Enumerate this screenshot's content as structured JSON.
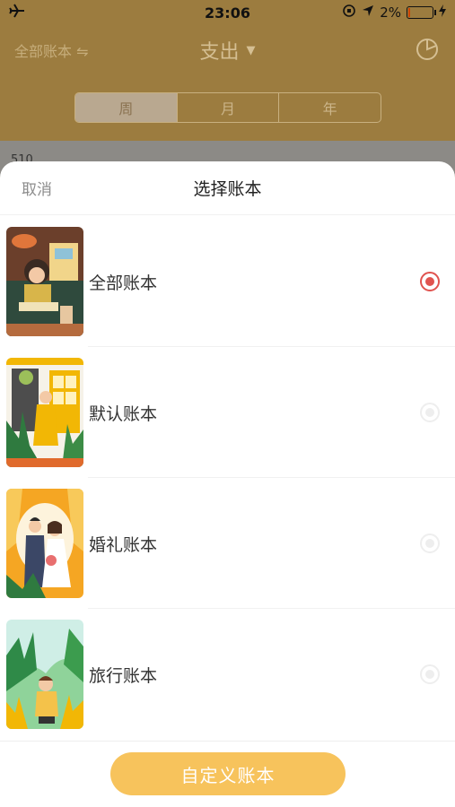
{
  "status": {
    "time": "23:06",
    "battery": "2%",
    "icons": [
      "airplane-icon",
      "rotation-lock-icon",
      "location-arrow-icon",
      "battery-icon",
      "charging-icon"
    ]
  },
  "topbar": {
    "left": "全部账本 ⇋",
    "title": "支出",
    "dropdown_icon": "▼",
    "right_icon": "pie-chart-icon"
  },
  "segments": [
    "周",
    "月",
    "年"
  ],
  "behind": {
    "peek_text": "510"
  },
  "sheet": {
    "cancel": "取消",
    "title": "选择账本",
    "books": [
      {
        "label": "全部账本",
        "selected": true
      },
      {
        "label": "默认账本",
        "selected": false
      },
      {
        "label": "婚礼账本",
        "selected": false
      },
      {
        "label": "旅行账本",
        "selected": false
      }
    ],
    "custom_button": "自定义账本"
  },
  "colors": {
    "accent": "#f7c35c",
    "selected_radio": "#e0534f",
    "dim_background": "#9c7c3f"
  }
}
